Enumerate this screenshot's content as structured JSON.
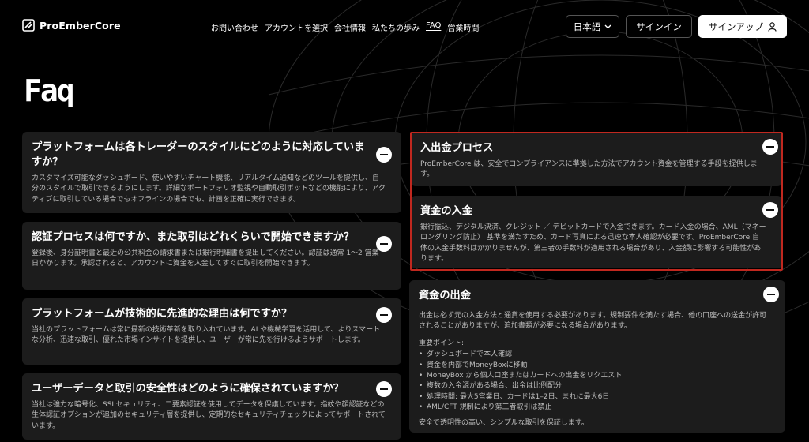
{
  "header": {
    "logo_text": "ProEmberCore",
    "nav": [
      {
        "label": "お問い合わせ"
      },
      {
        "label": "アカウントを選択"
      },
      {
        "label": "会社情報"
      },
      {
        "label": "私たちの歩み"
      },
      {
        "label": "FAQ",
        "active": true
      },
      {
        "label": "営業時間"
      }
    ],
    "language_label": "日本語",
    "signin_label": "サインイン",
    "signup_label": "サインアップ"
  },
  "page_title": "Faq",
  "faq_left": [
    {
      "question": "プラットフォームは各トレーダーのスタイルにどのように対応していますか？",
      "answer": "カスタマイズ可能なダッシュボード、使いやすいチャート機能、リアルタイム通知などのツールを提供し、自分のスタイルで取引できるようにします。詳細なポートフォリオ監視や自動取引ボットなどの機能により、アクティブに取引している場合でもオフラインの場合でも、計画を正確に実行できます。"
    },
    {
      "question": "認証プロセスは何ですか、また取引はどれくらいで開始できますか？",
      "answer": "登録後、身分証明書と最近の公共料金の請求書または銀行明細書を提出してください。認証は通常 1〜2 営業日かかります。承認されると、アカウントに資金を入金してすぐに取引を開始できます。"
    },
    {
      "question": "プラットフォームが技術的に先進的な理由は何ですか？",
      "answer": "当社のプラットフォームは常に最新の技術革新を取り入れています。AI や機械学習を活用して、よりスマートな分析、迅速な取引、優れた市場インサイトを提供し、ユーザーが常に先を行けるようサポートします。"
    },
    {
      "question": "ユーザーデータと取引の安全性はどのように確保されていますか？",
      "answer": "当社は強力な暗号化、SSLセキュリティ、二要素認証を使用してデータを保護しています。指紋や顔認証などの生体認証オプションが追加のセキュリティ層を提供し、定期的なセキュリティチェックによってサポートされています。"
    }
  ],
  "faq_right": [
    {
      "question": "入出金プロセス",
      "answer": "ProEmberCore は、安全でコンプライアンスに準拠した方法でアカウント資金を管理する手段を提供します。"
    },
    {
      "question": "資金の入金",
      "answer": "銀行振込、デジタル決済、クレジット ／ デビットカードで入金できます。カード入金の場合、AML（マネーロンダリング防止） 基準を満たすため、カード写真による迅速な本人確認が必要です。ProEmberCore 自体の入金手数料はかかりませんが、第三者の手数料が適用される場合があり、入金額に影響する可能性があります。"
    },
    {
      "question": "資金の出金",
      "answer": "出金は必ず元の入金方法と通貨を使用する必要があります。規制要件を満たす場合、他の口座への送金が許可されることがありますが、追加書類が必要になる場合があります。",
      "points_title": "重要ポイント:",
      "points": [
        "ダッシュボードで本人確認",
        "資金を内部でMoneyBoxに移動",
        "MoneyBox から個人口座またはカードへの出金をリクエスト",
        "複数の入金源がある場合、出金は比例配分",
        "処理時間: 最大5営業日、カードは1–2日、まれに最大6日",
        "AML/CFT 規制により第三者取引は禁止"
      ],
      "footer": "安全で透明性の高い、シンプルな取引を保証します。"
    }
  ],
  "colors": {
    "background": "#000000",
    "card": "#1c1c1c",
    "highlight": "#c0281f"
  }
}
